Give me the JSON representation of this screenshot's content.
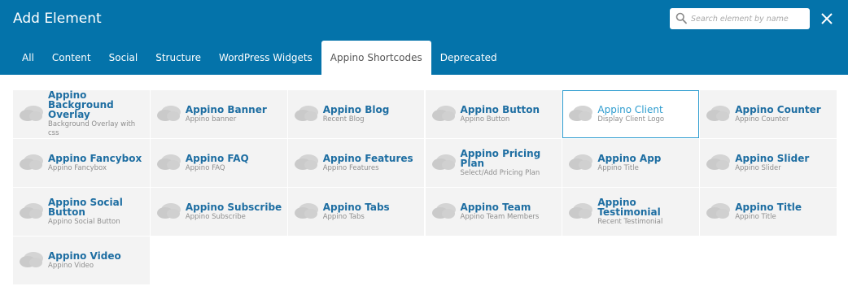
{
  "header": {
    "title": "Add Element",
    "search_placeholder": "Search element by name",
    "search_value": "",
    "close_icon": "close-icon"
  },
  "tabs": [
    {
      "label": "All"
    },
    {
      "label": "Content"
    },
    {
      "label": "Social"
    },
    {
      "label": "Structure"
    },
    {
      "label": "WordPress Widgets"
    },
    {
      "label": "Appino Shortcodes",
      "active": true
    },
    {
      "label": "Deprecated"
    }
  ],
  "colors": {
    "header_bg": "#0473aa",
    "card_bg": "#f3f3f3",
    "name_color": "#1e6ea2",
    "selected_border": "#2d9ccf"
  },
  "elements": [
    {
      "name": "Appino Background Overlay",
      "desc": "Background Overlay with css",
      "icon": "element-icon"
    },
    {
      "name": "Appino Banner",
      "desc": "Appino banner",
      "icon": "element-icon"
    },
    {
      "name": "Appino Blog",
      "desc": "Recent Blog",
      "icon": "element-icon"
    },
    {
      "name": "Appino Button",
      "desc": "Appino Button",
      "icon": "element-icon"
    },
    {
      "name": "Appino Client",
      "desc": "Display Client Logo",
      "icon": "element-icon",
      "selected": true
    },
    {
      "name": "Appino Counter",
      "desc": "Appino Counter",
      "icon": "element-icon"
    },
    {
      "name": "Appino Fancybox",
      "desc": "Appino Fancybox",
      "icon": "element-icon"
    },
    {
      "name": "Appino FAQ",
      "desc": "Appino FAQ",
      "icon": "element-icon"
    },
    {
      "name": "Appino Features",
      "desc": "Appino Features",
      "icon": "element-icon"
    },
    {
      "name": "Appino Pricing Plan",
      "desc": "Select/Add Pricing Plan",
      "icon": "element-icon"
    },
    {
      "name": "Appino App",
      "desc": "Appino Title",
      "icon": "element-icon"
    },
    {
      "name": "Appino Slider",
      "desc": "Appino Slider",
      "icon": "element-icon"
    },
    {
      "name": "Appino Social Button",
      "desc": "Appino Social Button",
      "icon": "element-icon"
    },
    {
      "name": "Appino Subscribe",
      "desc": "Appino Subscribe",
      "icon": "element-icon"
    },
    {
      "name": "Appino Tabs",
      "desc": "Appino Tabs",
      "icon": "element-icon"
    },
    {
      "name": "Appino Team",
      "desc": "Appino Team Members",
      "icon": "element-icon"
    },
    {
      "name": "Appino Testimonial",
      "desc": "Recent Testimonial",
      "icon": "element-icon"
    },
    {
      "name": "Appino Title",
      "desc": "Appino Title",
      "icon": "element-icon"
    },
    {
      "name": "Appino Video",
      "desc": "Appino Video",
      "icon": "element-icon"
    }
  ]
}
